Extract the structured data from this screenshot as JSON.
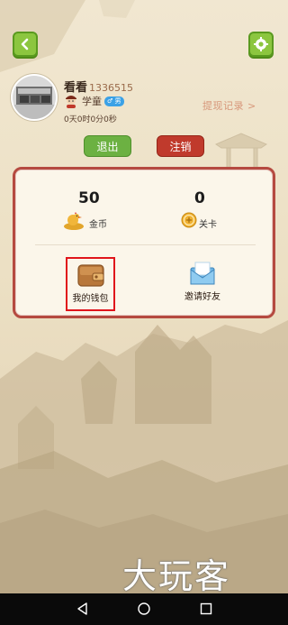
{
  "header": {
    "back_icon": "chevron-left-icon",
    "settings_icon": "gear-icon"
  },
  "profile": {
    "name": "看看",
    "uid": "1336515",
    "rank": "学童",
    "gender_symbol": "♂ 男",
    "online_time": "0天0时0分0秒",
    "withdraw_records": "提现记录 >"
  },
  "actions": {
    "logout_label": "退出",
    "cancel_account_label": "注销"
  },
  "stats": {
    "coins_value": "50",
    "coins_label": "金币",
    "levels_value": "0",
    "levels_label": "关卡"
  },
  "features": {
    "wallet_label": "我的钱包",
    "invite_label": "邀请好友"
  },
  "watermark": "大玩客",
  "colors": {
    "green": "#8cc63f",
    "red": "#c03a2c",
    "panel_border": "#b54a40",
    "highlight": "#e0151b",
    "link": "#d79679"
  }
}
